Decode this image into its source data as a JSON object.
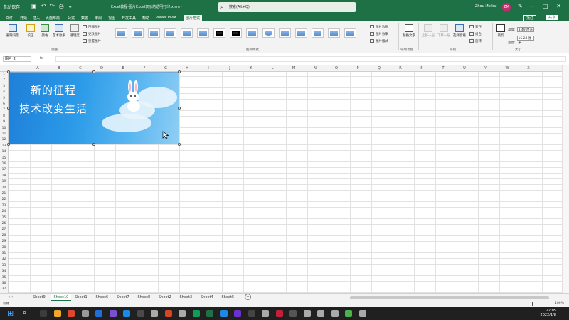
{
  "titlebar": {
    "autosave_label": "自动保存",
    "document_title": "Excel教程-图片Excel表示的透明打印.xlsm  ·",
    "search_placeholder": "搜索(Alt+Q)",
    "user_name": "Zhou Meikai",
    "user_initials": "ZM"
  },
  "menu_tabs": [
    "文件",
    "开始",
    "插入",
    "页面布局",
    "公式",
    "数据",
    "审阅",
    "视图",
    "开发工具",
    "帮助",
    "Power Pivot",
    "图片格式"
  ],
  "active_tab": "图片格式",
  "menu_right": {
    "comment": "批注",
    "share": "共享"
  },
  "ribbon": {
    "adjust_buttons": [
      {
        "label": "删除背景"
      },
      {
        "label": "校正"
      },
      {
        "label": "颜色"
      },
      {
        "label": "艺术效果"
      },
      {
        "label": "透明度"
      }
    ],
    "adjust_small": [
      "压缩图片",
      "更改图片",
      "重置图片"
    ],
    "group_adjust": "调整",
    "group_styles": "图片样式",
    "style_count": 15,
    "styles_small": [
      "图片边框",
      "图片效果",
      "图片版式"
    ],
    "group_accessibility": "辅助功能",
    "alt_text": "替换文字",
    "arrange_big": [
      "上移一层",
      "下移一层",
      "选择窗格"
    ],
    "arrange_small": [
      "对齐",
      "组合",
      "旋转"
    ],
    "group_arrange": "排列",
    "crop_label": "裁剪",
    "height_label": "高度:",
    "height_value": "3.49 厘米",
    "width_label": "宽度:",
    "width_value": "15.24 厘米",
    "group_size": "大小"
  },
  "formula_bar": {
    "name_box": "图片 2",
    "fx": "fx"
  },
  "columns": [
    "A",
    "B",
    "C",
    "D",
    "E",
    "F",
    "G",
    "H",
    "I",
    "J",
    "K",
    "L",
    "M",
    "N",
    "O",
    "P",
    "Q",
    "R",
    "S",
    "T",
    "U",
    "V",
    "W",
    "X"
  ],
  "row_count": 37,
  "picture": {
    "line1": "新的征程",
    "line2": "技术改变生活"
  },
  "sheets": [
    "Sheet9",
    "Sheet10",
    "Sheet1",
    "Sheet6",
    "Sheet7",
    "Sheet8",
    "Sheet2",
    "Sheet3",
    "Sheet4",
    "Sheet5"
  ],
  "active_sheet": "Sheet10",
  "status": {
    "ready": "就绪",
    "zoom": "100%"
  },
  "taskbar": {
    "time": "22:05",
    "date": "2022/1/8"
  },
  "colors": {
    "excel_green": "#1e7145",
    "picture_blue": "#1f7fd8"
  }
}
